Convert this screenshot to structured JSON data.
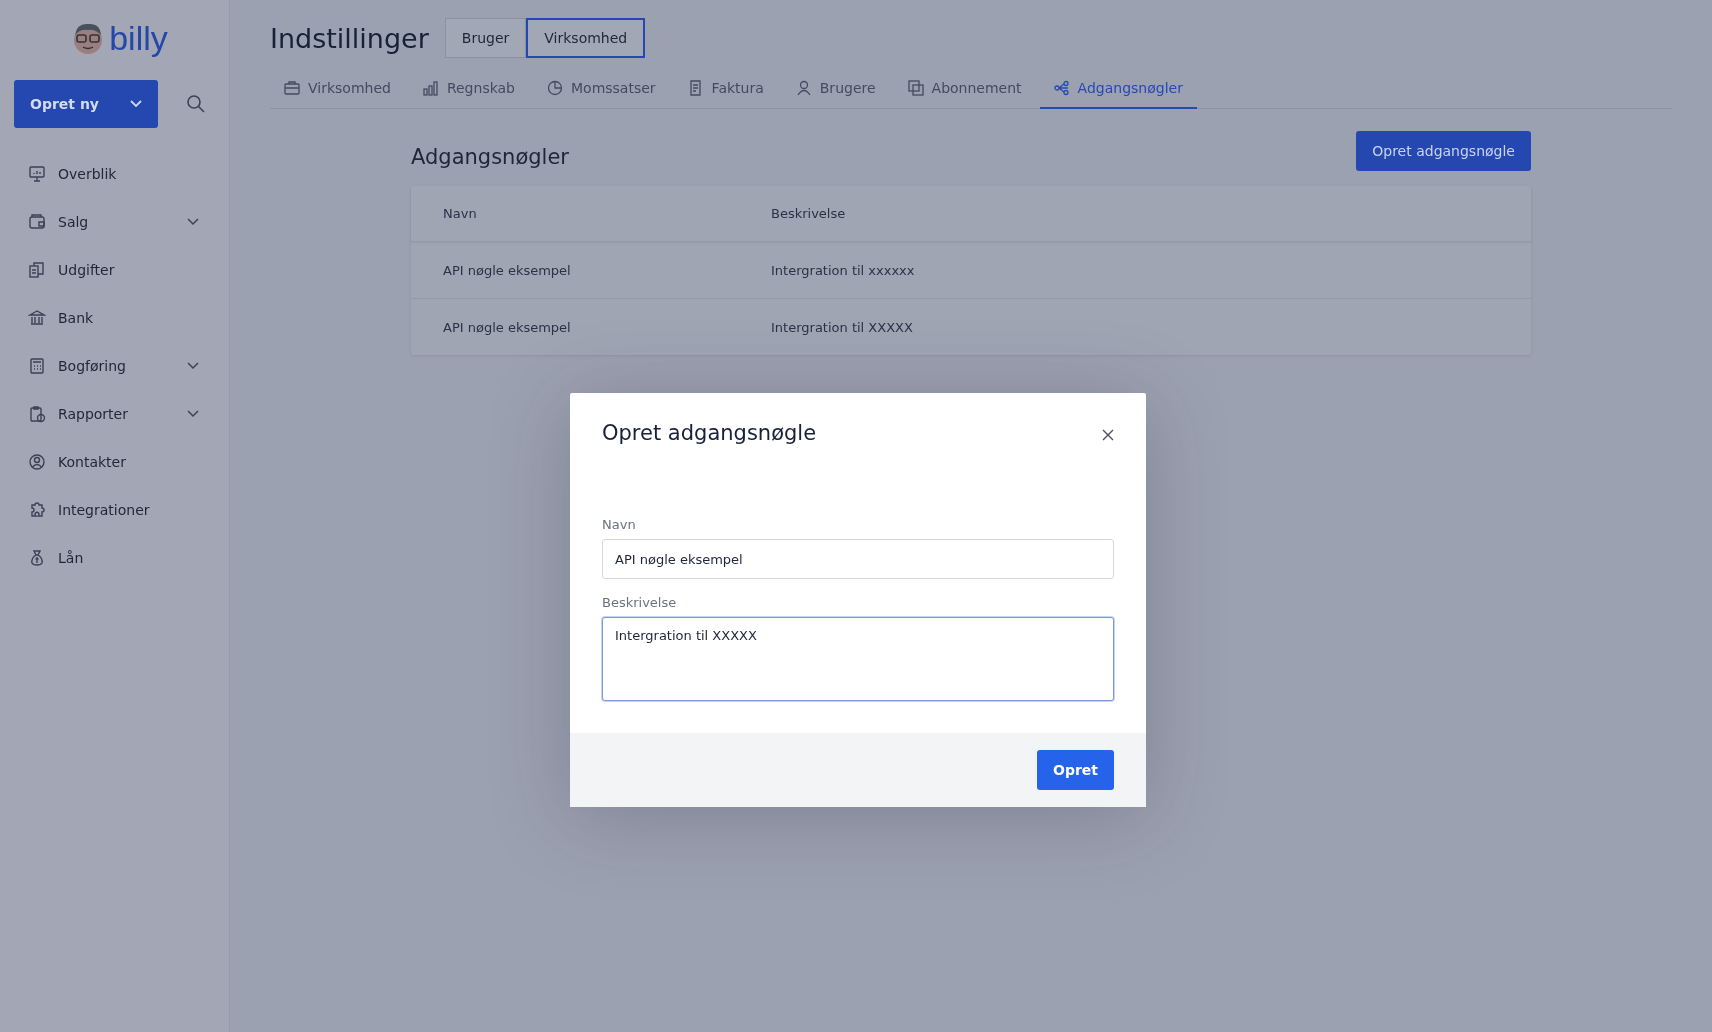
{
  "sidebar": {
    "logo": "billy",
    "create_button": "Opret ny",
    "items": [
      {
        "label": "Overblik",
        "expandable": false
      },
      {
        "label": "Salg",
        "expandable": true
      },
      {
        "label": "Udgifter",
        "expandable": false
      },
      {
        "label": "Bank",
        "expandable": false
      },
      {
        "label": "Bogføring",
        "expandable": true
      },
      {
        "label": "Rapporter",
        "expandable": true
      },
      {
        "label": "Kontakter",
        "expandable": false
      },
      {
        "label": "Integrationer",
        "expandable": false
      },
      {
        "label": "Lån",
        "expandable": false
      }
    ]
  },
  "header": {
    "title": "Indstillinger",
    "scope_tabs": [
      {
        "label": "Bruger",
        "selected": false
      },
      {
        "label": "Virksomhed",
        "selected": true
      }
    ]
  },
  "tabs": [
    {
      "label": "Virksomhed",
      "selected": false
    },
    {
      "label": "Regnskab",
      "selected": false
    },
    {
      "label": "Momssatser",
      "selected": false
    },
    {
      "label": "Faktura",
      "selected": false
    },
    {
      "label": "Brugere",
      "selected": false
    },
    {
      "label": "Abonnement",
      "selected": false
    },
    {
      "label": "Adgangsnøgler",
      "selected": true
    }
  ],
  "section": {
    "title": "Adgangsnøgler",
    "create_button": "Opret adgangsnøgle"
  },
  "table": {
    "columns": [
      "Navn",
      "Beskrivelse"
    ],
    "rows": [
      [
        "API nøgle eksempel",
        "Intergration til xxxxxx"
      ],
      [
        "API nøgle eksempel",
        "Intergration til XXXXX"
      ]
    ]
  },
  "dialog": {
    "title": "Opret adgangsnøgle",
    "fields": [
      {
        "label": "Navn",
        "value": "API nøgle eksempel",
        "kind": "input",
        "focused": false
      },
      {
        "label": "Beskrivelse",
        "value": "Intergration til XXXXX",
        "kind": "textarea",
        "focused": true
      }
    ],
    "submit": "Opret"
  }
}
